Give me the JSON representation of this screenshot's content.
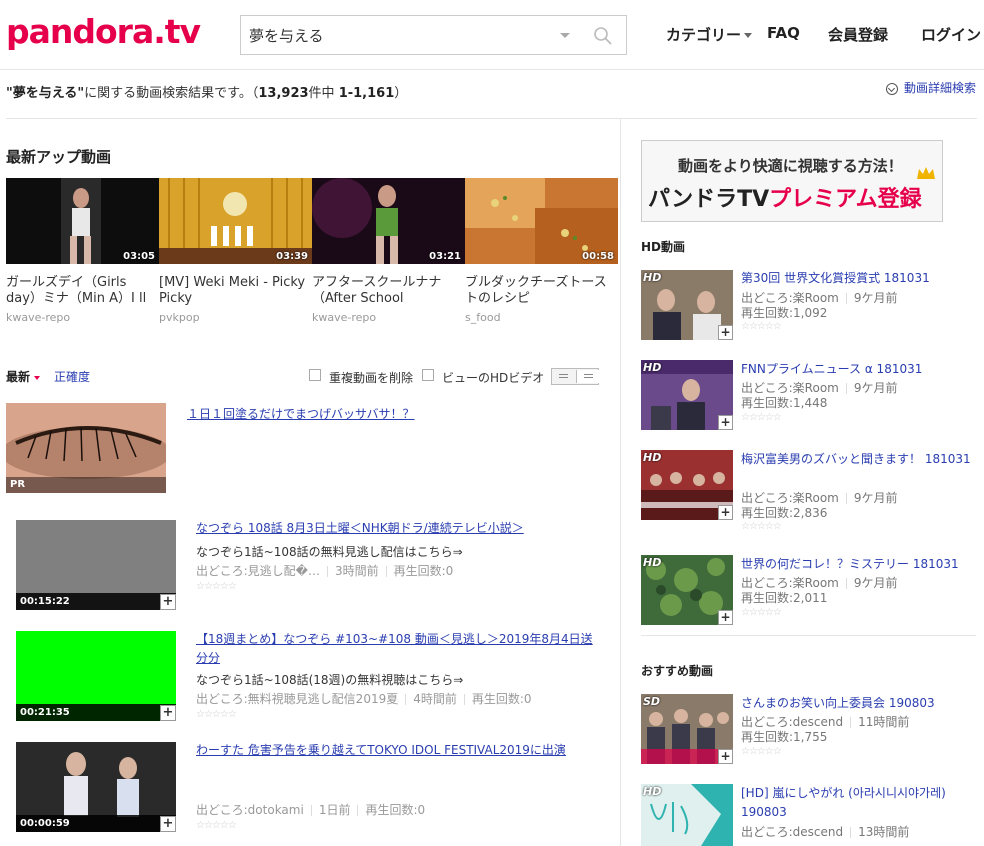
{
  "header": {
    "logo": "pandora.tv",
    "search_value": "夢を与える",
    "nav": {
      "category": "カテゴリー",
      "faq": "FAQ",
      "register": "会員登録",
      "login": "ログイン"
    }
  },
  "summary": {
    "keyword": "\"夢を与える\"",
    "text": "に関する動画検索結果です。",
    "count_open": "（",
    "total": "13,923",
    "mid": "件中 ",
    "range": "1-1,161",
    "count_close": "）",
    "detail_search": "動画詳細検索"
  },
  "latest": {
    "title": "最新アップ動画",
    "items": [
      {
        "title": "ガールズデイ（Girls day）ミナ（Min A）I ll",
        "source": "kwave-repo",
        "duration": "03:05"
      },
      {
        "title": "[MV] Weki Meki - Picky Picky",
        "source": "pvkpop",
        "duration": "03:39"
      },
      {
        "title": "アフタースクールナナ（After School",
        "source": "kwave-repo",
        "duration": "03:21"
      },
      {
        "title": "ブルダックチーズトーストのレシピ",
        "source": "s_food",
        "duration": "00:58"
      }
    ]
  },
  "sort": {
    "latest": "最新",
    "accuracy": "正確度",
    "dedupe": "重複動画を削除",
    "hd_only": "ビューのHDビデオ"
  },
  "pr": {
    "label": "PR",
    "link": "１日１回塗るだけでまつげバッサバサ！？"
  },
  "results": [
    {
      "title": "なつぞら 108話 8月3日土曜＜NHK朝ドラ/連続テレビ小説＞",
      "desc": "なつぞら1話~108話の無料見逃し配信はこちら⇒",
      "source": "出どころ:見逃し配�…",
      "time": "3時間前",
      "views": "再生回数:0",
      "duration": "00:15:22",
      "color": "#808080"
    },
    {
      "title": "【18週まとめ】なつぞら #103~#108 動画＜見逃し＞2019年8月4日送分分",
      "desc": "なつぞら1話~108話(18週)の無料視聴はこちら⇒",
      "source": "出どころ:無料視聴見逃し配信2019夏",
      "time": "4時間前",
      "views": "再生回数:0",
      "duration": "00:21:35",
      "color": "#00ff00"
    },
    {
      "title": "わーすた 危害予告を乗り越えてTOKYO IDOL FESTIVAL2019に出演",
      "desc": "",
      "source": "出どころ:dotokami",
      "time": "1日前",
      "views": "再生回数:0",
      "duration": "00:00:59",
      "color": "#3a3a3a"
    }
  ],
  "banner": {
    "line1": "動画をより快適に視聴する方法！",
    "line2a": "パンドラTV",
    "line2b": "プレミアム登録"
  },
  "hd": {
    "title": "HD動画",
    "items": [
      {
        "badge": "HD",
        "title": "第30回 世界文化賞授賞式 181031",
        "source": "出どころ:楽Room",
        "time": "9ケ月前",
        "views": "再生回数:1,092",
        "color": "#6b5a4a"
      },
      {
        "badge": "HD",
        "title": "FNNプライムニュース α 181031",
        "source": "出どころ:楽Room",
        "time": "9ケ月前",
        "views": "再生回数:1,448",
        "color": "#5a3f7a"
      },
      {
        "badge": "HD",
        "title": "梅沢富美男のズバッと聞きます！ 181031",
        "source": "出どころ:楽Room",
        "time": "9ケ月前",
        "views": "再生回数:2,836",
        "color": "#8a2a2a"
      },
      {
        "badge": "HD",
        "title": "世界の何だコレ！？ミステリー 181031",
        "source": "出どころ:楽Room",
        "time": "9ケ月前",
        "views": "再生回数:2,011",
        "color": "#4a6a3a"
      }
    ]
  },
  "recommend": {
    "title": "おすすめ動画",
    "items": [
      {
        "badge": "SD",
        "title": "さんまのお笑い向上委員会 190803",
        "source": "出どころ:descend",
        "time": "11時間前",
        "views": "再生回数:1,755",
        "color": "#7a6a5a"
      },
      {
        "badge": "HD",
        "title": "[HD] 嵐にしやがれ (아라시니시야가레) 190803",
        "source": "出どころ:descend",
        "time": "13時間前",
        "views": "",
        "color": "#2fb3b0"
      }
    ]
  },
  "stars": "☆☆☆☆☆"
}
